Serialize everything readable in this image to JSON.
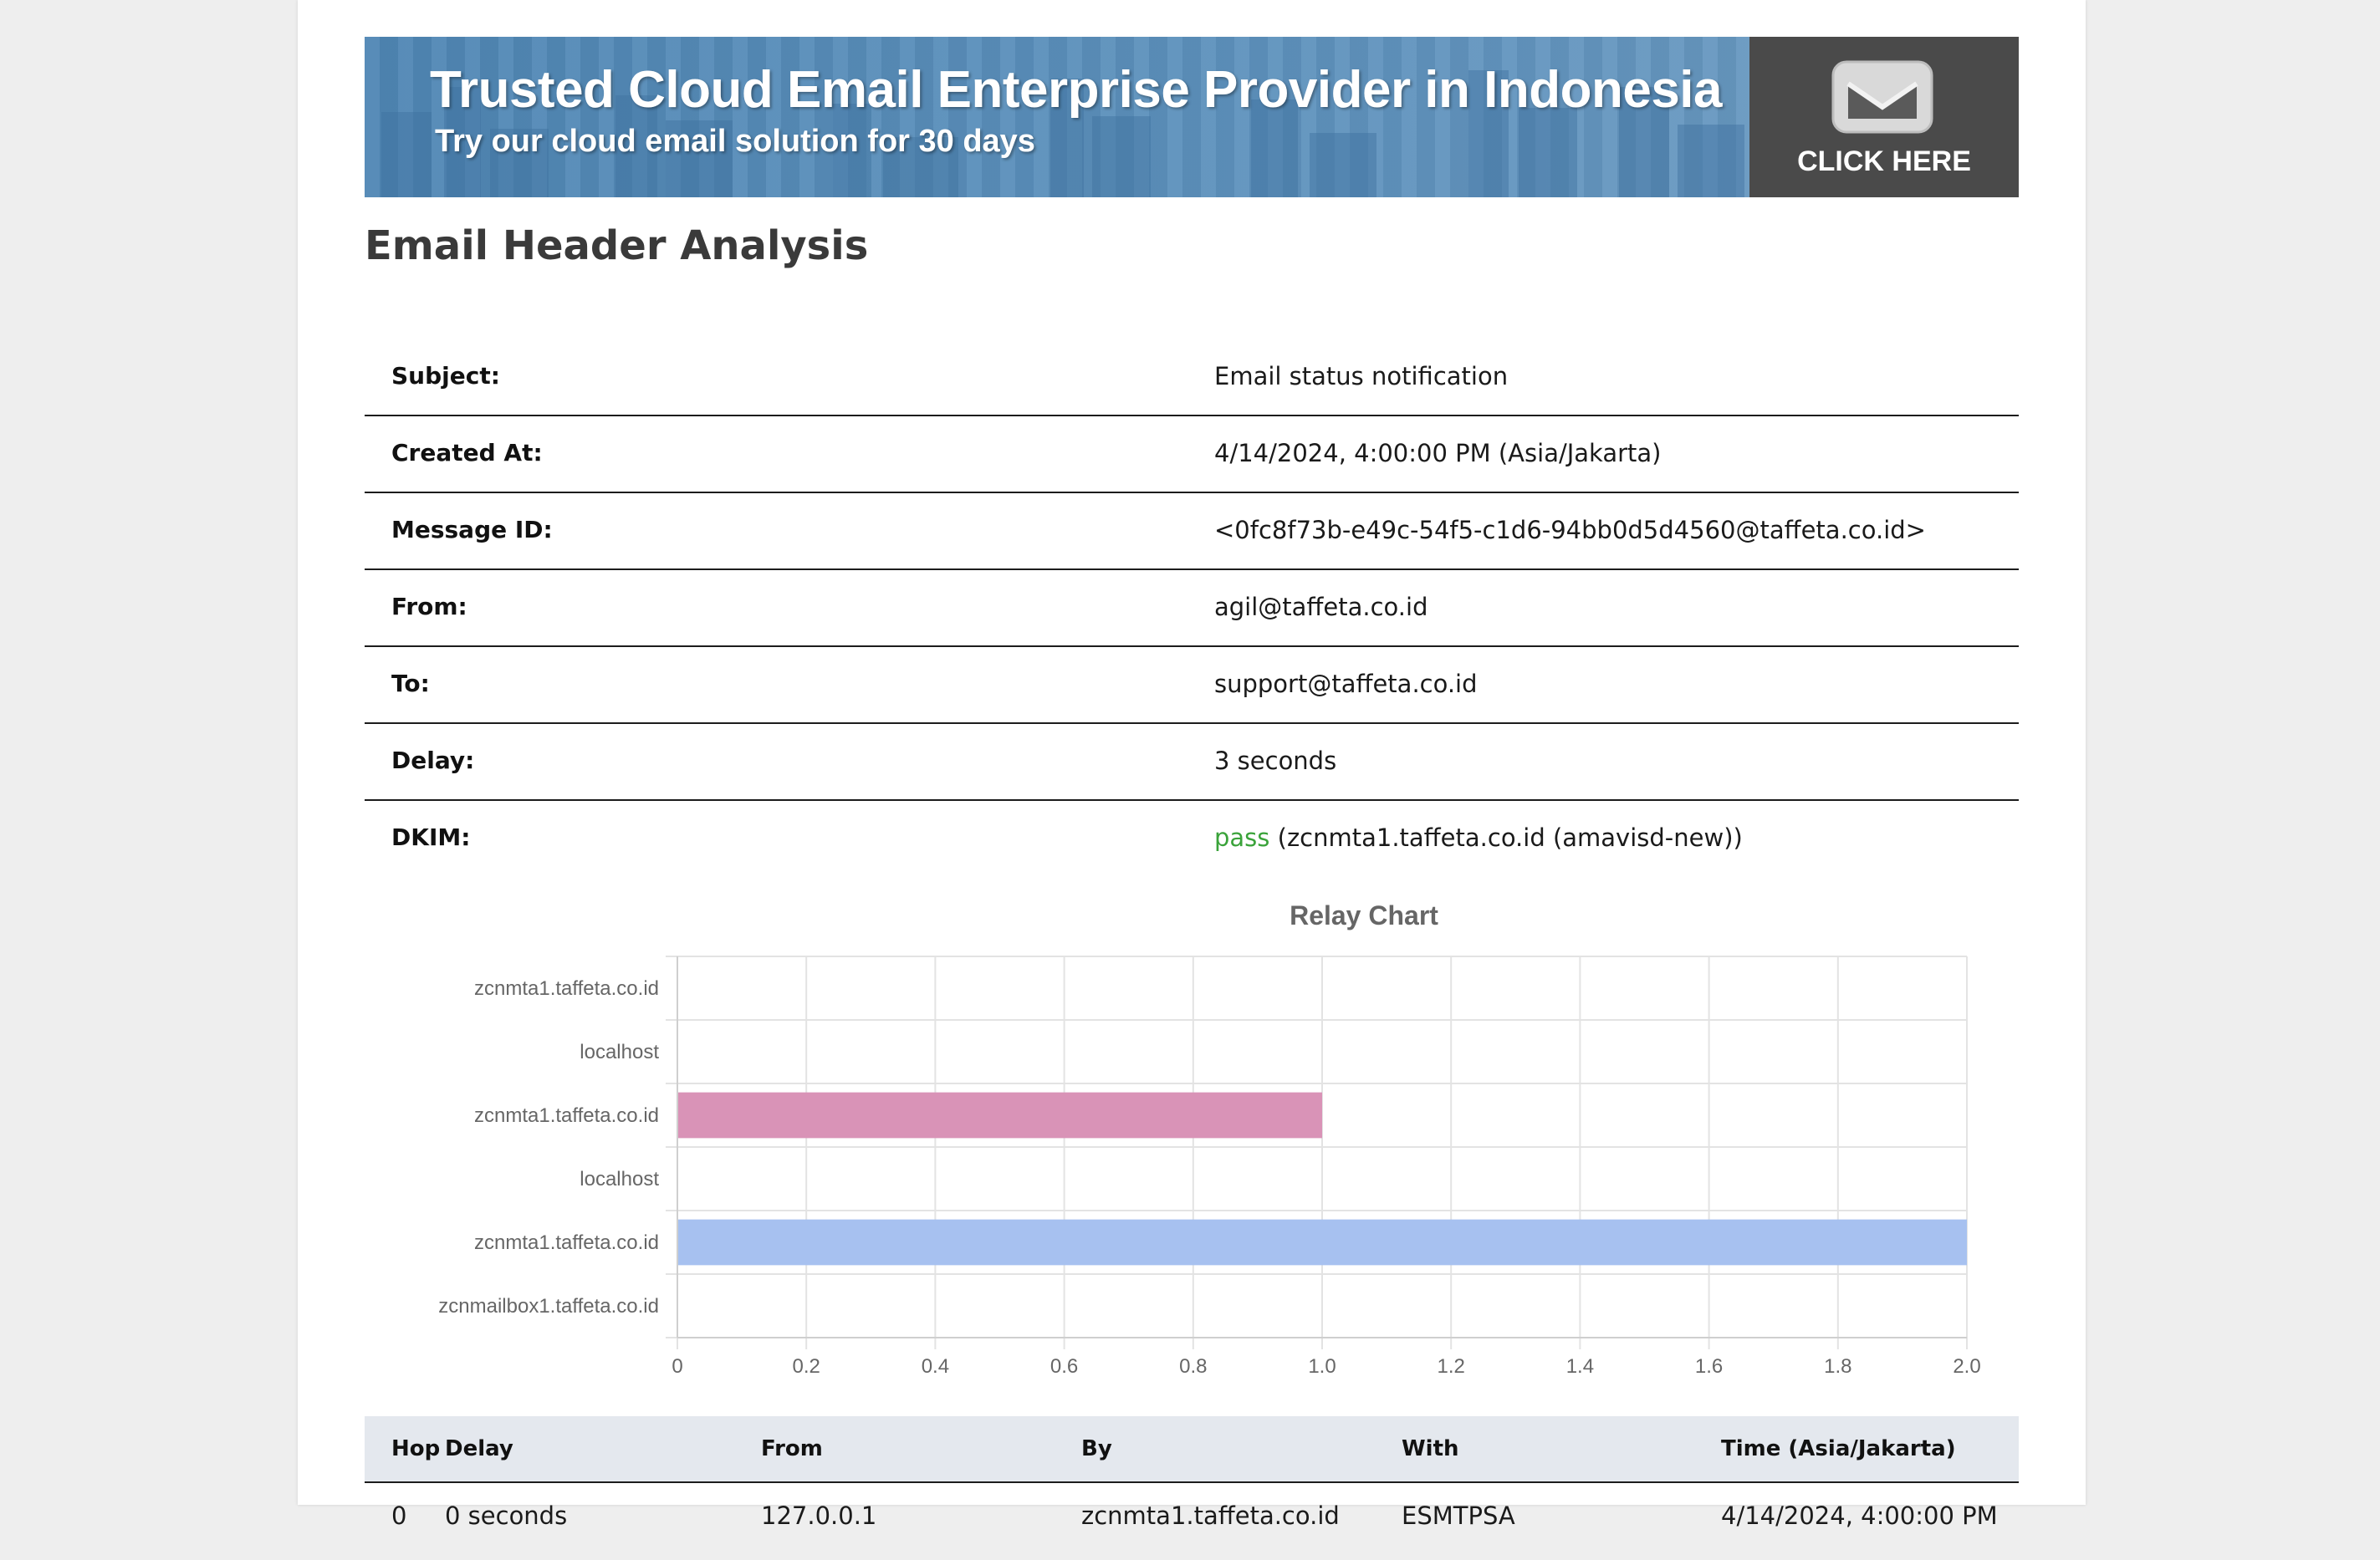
{
  "banner": {
    "title": "Trusted Cloud Email Enterprise Provider in Indonesia",
    "subtitle": "Try our cloud email solution for 30 days",
    "cta_label": "CLICK HERE",
    "cta_icon": "envelope-icon",
    "colors": {
      "background": "#5a8fbb",
      "cta_background": "#4a4a4a"
    }
  },
  "page_title": "Email Header Analysis",
  "info": {
    "rows": [
      {
        "label": "Subject:",
        "value": "Email status notification"
      },
      {
        "label": "Created At:",
        "value": "4/14/2024, 4:00:00 PM (Asia/Jakarta)"
      },
      {
        "label": "Message ID:",
        "value": "<0fc8f73b-e49c-54f5-c1d6-94bb0d5d4560@taffeta.co.id>"
      },
      {
        "label": "From:",
        "value": "agil@taffeta.co.id"
      },
      {
        "label": "To:",
        "value": "support@taffeta.co.id"
      },
      {
        "label": "Delay:",
        "value": "3 seconds"
      }
    ],
    "dkim": {
      "label": "DKIM:",
      "status": "pass",
      "status_color": "#3aa33a",
      "detail": "(zcnmta1.taffeta.co.id (amavisd-new))"
    }
  },
  "chart_data": {
    "type": "bar",
    "orientation": "horizontal",
    "title": "Relay Chart",
    "categories": [
      "zcnmta1.taffeta.co.id",
      "localhost",
      "zcnmta1.taffeta.co.id",
      "localhost",
      "zcnmta1.taffeta.co.id",
      "zcnmailbox1.taffeta.co.id"
    ],
    "values": [
      0,
      0,
      1.0,
      0,
      2.0,
      0
    ],
    "bar_colors": [
      "#d993b7",
      "#d993b7",
      "#d993b7",
      "#a7c1f0",
      "#a7c1f0",
      "#a7c1f0"
    ],
    "xlim": [
      0,
      2.0
    ],
    "xticks": [
      "0",
      "0.2",
      "0.4",
      "0.6",
      "0.8",
      "1.0",
      "1.2",
      "1.4",
      "1.6",
      "1.8",
      "2.0"
    ],
    "grid": true
  },
  "hops": {
    "headers": {
      "hop": "Hop",
      "delay": "Delay",
      "from": "From",
      "by": "By",
      "with": "With",
      "time": "Time (Asia/Jakarta)"
    },
    "rows": [
      {
        "hop": "0",
        "delay": "0 seconds",
        "from": "127.0.0.1",
        "by": "zcnmta1.taffeta.co.id",
        "with": "ESMTPSA",
        "time": "4/14/2024, 4:00:00 PM"
      }
    ]
  }
}
